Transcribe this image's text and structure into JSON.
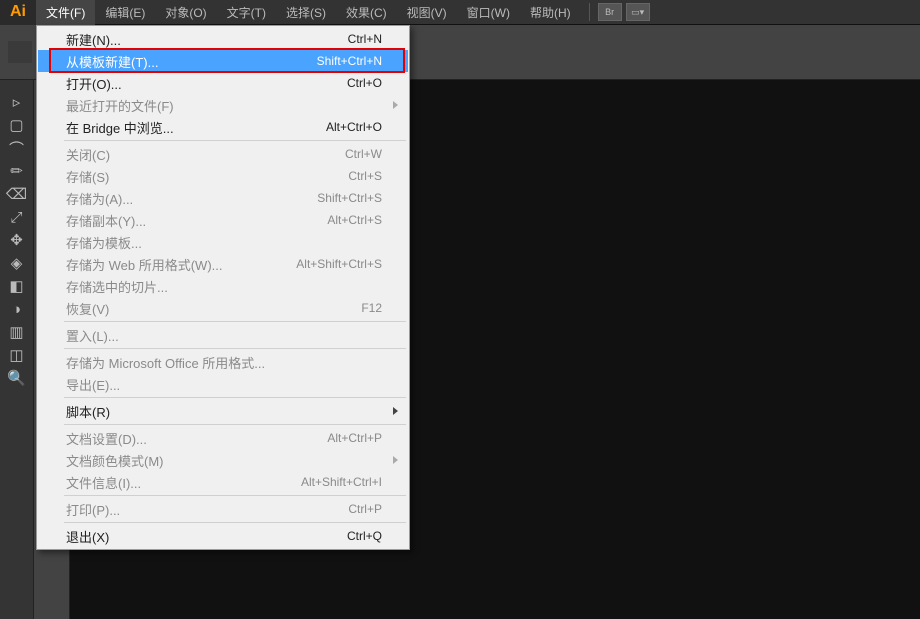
{
  "app_logo": "Ai",
  "menubar": [
    "文件(F)",
    "编辑(E)",
    "对象(O)",
    "文字(T)",
    "选择(S)",
    "效果(C)",
    "视图(V)",
    "窗口(W)",
    "帮助(H)"
  ],
  "menubar_active_index": 0,
  "menubar_icons": [
    "Br",
    "layout"
  ],
  "dropdown": {
    "groups": [
      [
        {
          "label": "新建(N)...",
          "shortcut": "Ctrl+N"
        },
        {
          "label": "从模板新建(T)...",
          "shortcut": "Shift+Ctrl+N",
          "highlight": true,
          "redbox": true
        },
        {
          "label": "打开(O)...",
          "shortcut": "Ctrl+O"
        },
        {
          "label": "最近打开的文件(F)",
          "submenu": true,
          "disabled": true
        },
        {
          "label": "在 Bridge 中浏览...",
          "shortcut": "Alt+Ctrl+O"
        }
      ],
      [
        {
          "label": "关闭(C)",
          "shortcut": "Ctrl+W",
          "disabled": true
        },
        {
          "label": "存储(S)",
          "shortcut": "Ctrl+S",
          "disabled": true
        },
        {
          "label": "存储为(A)...",
          "shortcut": "Shift+Ctrl+S",
          "disabled": true
        },
        {
          "label": "存储副本(Y)...",
          "shortcut": "Alt+Ctrl+S",
          "disabled": true
        },
        {
          "label": "存储为模板...",
          "disabled": true
        },
        {
          "label": "存储为 Web 所用格式(W)...",
          "shortcut": "Alt+Shift+Ctrl+S",
          "disabled": true
        },
        {
          "label": "存储选中的切片...",
          "disabled": true
        },
        {
          "label": "恢复(V)",
          "shortcut": "F12",
          "disabled": true
        }
      ],
      [
        {
          "label": "置入(L)...",
          "disabled": true
        }
      ],
      [
        {
          "label": "存储为 Microsoft Office 所用格式...",
          "disabled": true
        },
        {
          "label": "导出(E)...",
          "disabled": true
        }
      ],
      [
        {
          "label": "脚本(R)",
          "submenu": true
        }
      ],
      [
        {
          "label": "文档设置(D)...",
          "shortcut": "Alt+Ctrl+P",
          "disabled": true
        },
        {
          "label": "文档颜色模式(M)",
          "submenu": true,
          "disabled": true
        },
        {
          "label": "文件信息(I)...",
          "shortcut": "Alt+Shift+Ctrl+I",
          "disabled": true
        }
      ],
      [
        {
          "label": "打印(P)...",
          "shortcut": "Ctrl+P",
          "disabled": true
        }
      ],
      [
        {
          "label": "退出(X)",
          "shortcut": "Ctrl+Q"
        }
      ]
    ]
  },
  "tools_left": [
    "selection",
    "magic-wand",
    "pen",
    "line",
    "paintbrush",
    "rotate",
    "width",
    "shape-builder",
    "mesh",
    "eyedropper",
    "symbol-sprayer",
    "artboard",
    "hand",
    "question"
  ],
  "tools_far_left": [
    "sel2",
    "rect",
    "arc",
    "pencil",
    "eraser",
    "scale",
    "free-transform",
    "perspective",
    "gradient",
    "blend",
    "column-graph",
    "slice",
    "zoom"
  ]
}
